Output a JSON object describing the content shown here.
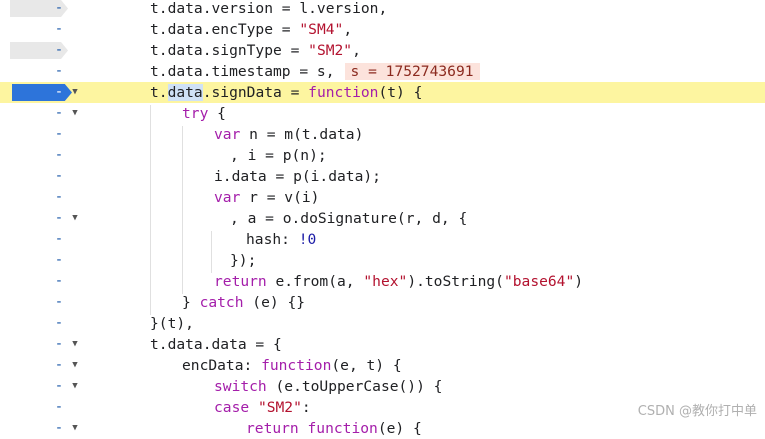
{
  "watermark": "CSDN @教你打中单",
  "lines": [
    {
      "indent": 150,
      "tokens": [
        [
          "",
          "t.data.version = l.version,"
        ]
      ]
    },
    {
      "indent": 150,
      "tokens": [
        [
          "",
          "t.data.encType = "
        ],
        [
          "str",
          "\"SM4\""
        ],
        [
          "",
          ","
        ]
      ]
    },
    {
      "indent": 150,
      "tokens": [
        [
          "",
          "t.data.signType = "
        ],
        [
          "str",
          "\"SM2\""
        ],
        [
          "",
          ","
        ]
      ]
    },
    {
      "indent": 150,
      "tokens": [
        [
          "",
          "t.data.timestamp = s,"
        ]
      ],
      "inline_value": "s = 1752743691"
    },
    {
      "indent": 150,
      "paused": true,
      "tokens": [
        [
          "",
          "t."
        ],
        [
          "sel",
          "data"
        ],
        [
          "",
          ".signData = "
        ],
        [
          "kw",
          "function"
        ],
        [
          "",
          "(t) {"
        ]
      ]
    },
    {
      "indent": 182,
      "tokens": [
        [
          "kw",
          "try"
        ],
        [
          "",
          " {"
        ]
      ]
    },
    {
      "indent": 214,
      "tokens": [
        [
          "kw",
          "var"
        ],
        [
          "",
          " n = m(t.data)"
        ]
      ]
    },
    {
      "indent": 230,
      "tokens": [
        [
          "",
          ", i = p(n);"
        ]
      ]
    },
    {
      "indent": 214,
      "tokens": [
        [
          "",
          "i.data = p(i.data);"
        ]
      ]
    },
    {
      "indent": 214,
      "tokens": [
        [
          "kw",
          "var"
        ],
        [
          "",
          " r = v(i)"
        ]
      ]
    },
    {
      "indent": 230,
      "tokens": [
        [
          "",
          ", a = o.doSignature(r, d, {"
        ]
      ]
    },
    {
      "indent": 246,
      "tokens": [
        [
          "",
          "hash: "
        ],
        [
          "num",
          "!0"
        ]
      ]
    },
    {
      "indent": 230,
      "tokens": [
        [
          "",
          "});"
        ]
      ]
    },
    {
      "indent": 214,
      "tokens": [
        [
          "kw",
          "return"
        ],
        [
          "",
          " e.from(a, "
        ],
        [
          "str",
          "\"hex\""
        ],
        [
          "",
          ").toString("
        ],
        [
          "str",
          "\"base64\""
        ],
        [
          "",
          ")"
        ]
      ]
    },
    {
      "indent": 182,
      "tokens": [
        [
          "",
          "} "
        ],
        [
          "kw",
          "catch"
        ],
        [
          "",
          " (e) {}"
        ]
      ]
    },
    {
      "indent": 150,
      "tokens": [
        [
          "",
          "}(t),"
        ]
      ]
    },
    {
      "indent": 150,
      "tokens": [
        [
          "",
          "t.data.data = {"
        ]
      ]
    },
    {
      "indent": 182,
      "tokens": [
        [
          "",
          "encData: "
        ],
        [
          "kw",
          "function"
        ],
        [
          "",
          "(e, t) {"
        ]
      ]
    },
    {
      "indent": 214,
      "tokens": [
        [
          "kw",
          "switch"
        ],
        [
          "",
          " (e.toUpperCase()) {"
        ]
      ]
    },
    {
      "indent": 214,
      "tokens": [
        [
          "kw",
          "case"
        ],
        [
          "",
          " "
        ],
        [
          "str",
          "\"SM2\""
        ],
        [
          "",
          ":"
        ]
      ]
    },
    {
      "indent": 246,
      "tokens": [
        [
          "kw",
          "return"
        ],
        [
          "",
          " "
        ],
        [
          "kw",
          "function"
        ],
        [
          "",
          "(e) {"
        ]
      ]
    }
  ],
  "gutter": [
    {
      "bp": "gray",
      "fold": false
    },
    {
      "bp": "none",
      "fold": false
    },
    {
      "bp": "gray",
      "fold": false
    },
    {
      "bp": "none",
      "fold": false
    },
    {
      "bp": "active",
      "fold": true
    },
    {
      "bp": "none",
      "fold": true
    },
    {
      "bp": "none",
      "fold": false
    },
    {
      "bp": "none",
      "fold": false
    },
    {
      "bp": "none",
      "fold": false
    },
    {
      "bp": "none",
      "fold": false
    },
    {
      "bp": "none",
      "fold": true
    },
    {
      "bp": "none",
      "fold": false
    },
    {
      "bp": "none",
      "fold": false
    },
    {
      "bp": "none",
      "fold": false
    },
    {
      "bp": "none",
      "fold": false
    },
    {
      "bp": "none",
      "fold": false
    },
    {
      "bp": "none",
      "fold": true
    },
    {
      "bp": "none",
      "fold": true
    },
    {
      "bp": "none",
      "fold": true
    },
    {
      "bp": "none",
      "fold": false
    },
    {
      "bp": "none",
      "fold": true
    }
  ]
}
